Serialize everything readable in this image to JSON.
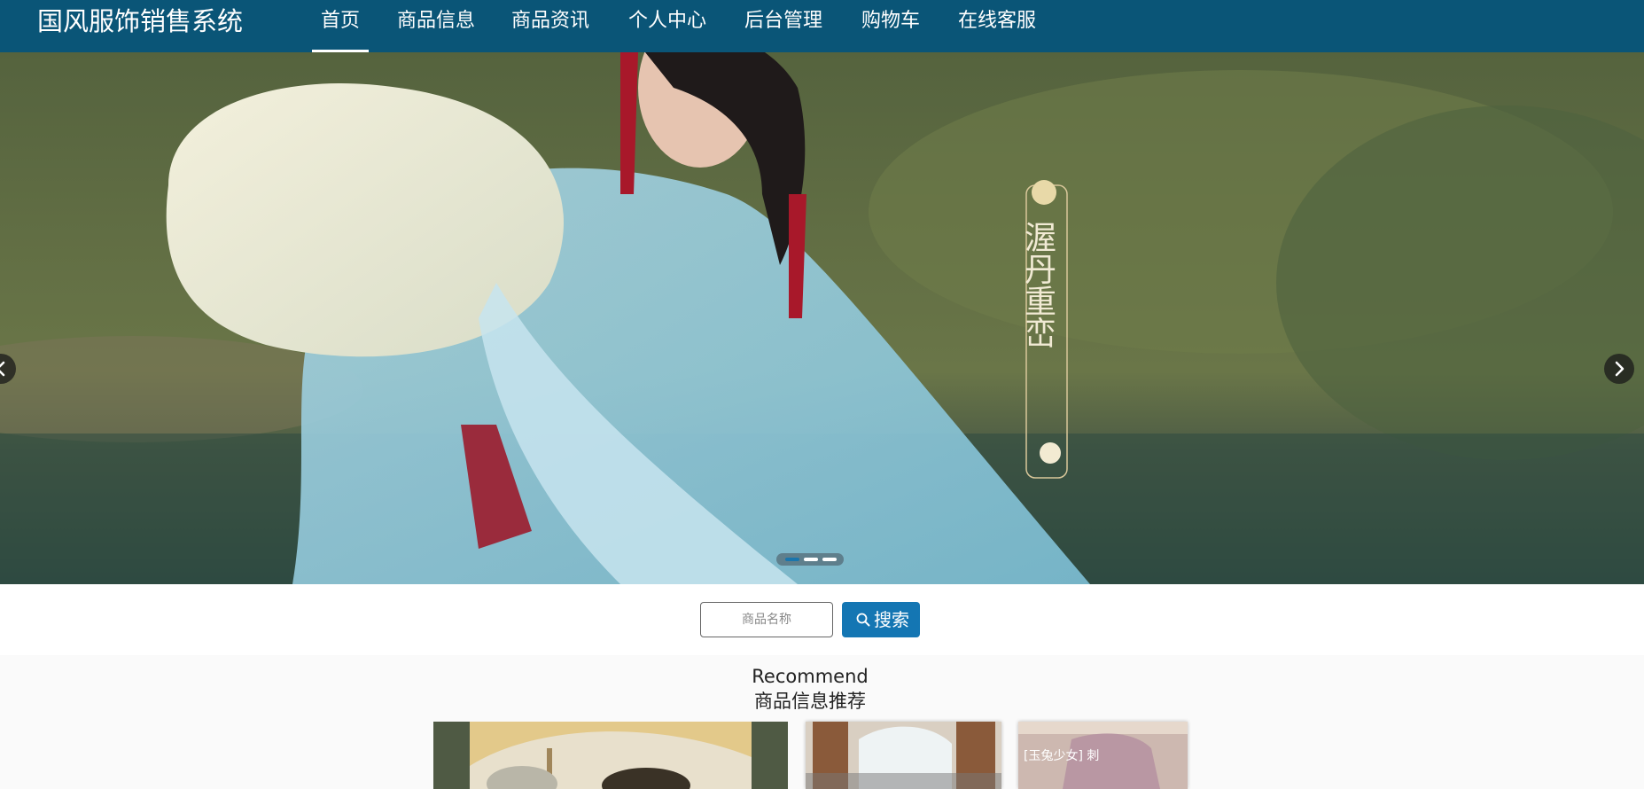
{
  "header": {
    "site_title": "国风服饰销售系统",
    "nav": [
      {
        "label": "首页",
        "active": true
      },
      {
        "label": "商品信息"
      },
      {
        "label": "商品资讯"
      },
      {
        "label": "个人中心"
      },
      {
        "label": "后台管理"
      },
      {
        "label": "购物车"
      },
      {
        "label": "在线客服"
      }
    ]
  },
  "banner": {
    "vertical_title": "渥丹重峦",
    "prev_icon": "chevron-left-icon",
    "next_icon": "chevron-right-icon",
    "slide_count": 3,
    "active_slide": 1
  },
  "search": {
    "placeholder": "商品名称",
    "value": "",
    "button_label": "搜索",
    "button_icon": "search-icon"
  },
  "recommend": {
    "title_en": "Recommend",
    "title_cn": "商品信息推荐",
    "cards": [
      {
        "caption": ""
      },
      {
        "caption": ""
      },
      {
        "caption": "[玉兔少女] 刺"
      }
    ]
  },
  "colors": {
    "header_bg": "#0a5577",
    "accent": "#1476b3",
    "page_bg": "#fafafa"
  }
}
